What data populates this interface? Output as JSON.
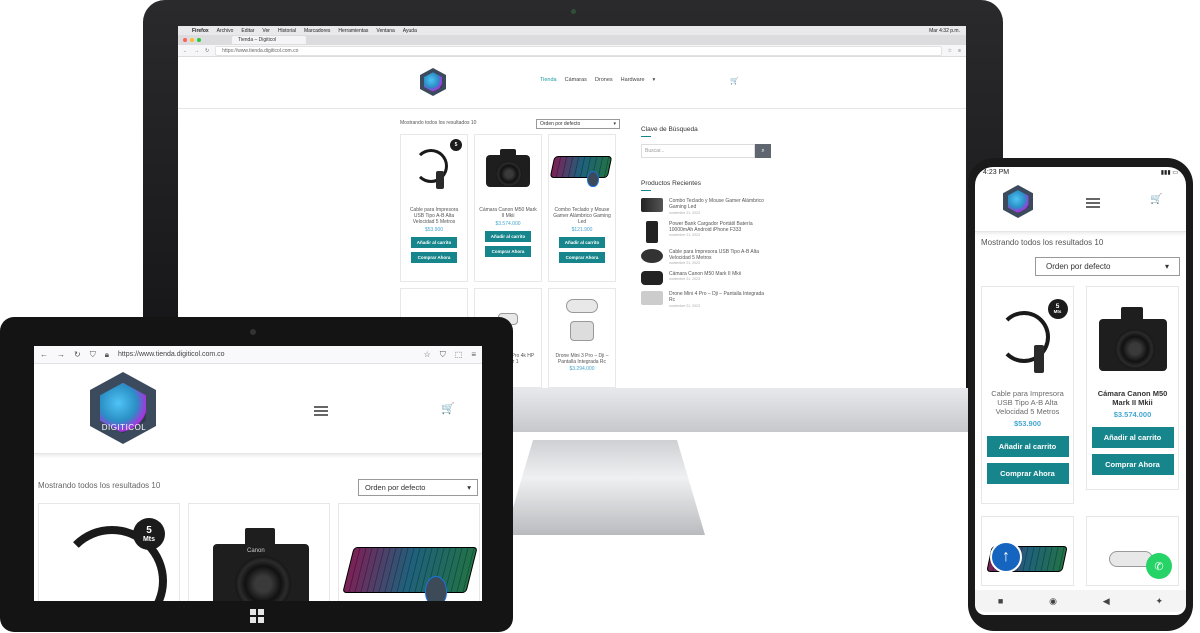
{
  "desktop": {
    "menubar": {
      "apple": "",
      "items": [
        "Firefox",
        "Archivo",
        "Editar",
        "Ver",
        "Historial",
        "Marcadores",
        "Herramientas",
        "Ventana",
        "Ayuda"
      ],
      "clock": "Mar 4:32 p.m."
    },
    "browser": {
      "tab_title": "Tienda – Digiticol",
      "url": "https://www.tienda.digiticol.com.co"
    },
    "nav": [
      "Tienda",
      "Cámaras",
      "Drones",
      "Hardware"
    ],
    "results_text": "Mostrando todos los resultados 10",
    "order_select": "Orden por defecto",
    "products": [
      {
        "title": "Cable para Impresora USB Tipo A-B Alta Velocidad 5 Metros",
        "price": "$53.900",
        "cart": "Añadir al carrito",
        "buy": "Comprar Ahora"
      },
      {
        "title": "Cámara Canon M50 Mark II Mkii",
        "price": "$3.574.000",
        "cart": "Añadir al carrito",
        "buy": "Comprar Ahora"
      },
      {
        "title": "Combo Teclado y Mouse Gamer Alámbrico Gaming Led",
        "price": "$121.900",
        "cart": "Añadir al carrito",
        "buy": "Comprar Ahora"
      }
    ],
    "row2_titles": [
      "",
      "Drone Mini 3 Pro 4k HP 5,8GHz 1",
      "Drone Mini 3 Pro – Dji – Pantalla Integrada Rc"
    ],
    "row2_prices": [
      "",
      "",
      "$3.294.000"
    ],
    "sidebar": {
      "search_title": "Clave de Búsqueda",
      "search_placeholder": "Buscar...",
      "recent_title": "Productos Recientes",
      "recent": [
        {
          "title": "Combo Teclado y Mouse Gamer Alámbrico Gaming Led",
          "date": "noviembre 21, 2023"
        },
        {
          "title": "Power Bank Cargador Portátil Batería 10000mAh Android iPhone F333",
          "date": "noviembre 21, 2023"
        },
        {
          "title": "Cable para Impresora USB Tipo A-B Alta Velocidad 5 Metros",
          "date": "noviembre 21, 2023"
        },
        {
          "title": "Cámara Canon M50 Mark II Mkii",
          "date": "noviembre 21, 2023"
        },
        {
          "title": "Drone Mini 4 Pro – Dji – Pantalla Integrada Rc",
          "date": "noviembre 21, 2023"
        }
      ]
    }
  },
  "tablet": {
    "url": "https://www.tienda.digiticol.com.co",
    "logo_text": "DIGITICOL",
    "results_text": "Mostrando todos los resultados 10",
    "order_select": "Orden por defecto",
    "badge_num": "5",
    "badge_unit": "Mts"
  },
  "phone": {
    "time": "4:23 PM",
    "results_text": "Mostrando todos los resultados 10",
    "order_select": "Orden por defecto",
    "badge_num": "5",
    "badge_unit": "Mts",
    "products": [
      {
        "title": "Cable para Impresora USB Tipo A-B Alta Velocidad 5 Metros",
        "price": "$53.900",
        "cart": "Añadir al carrito",
        "buy": "Comprar Ahora"
      },
      {
        "title": "Cámara Canon M50 Mark II Mkii",
        "price": "$3.574.000",
        "cart": "Añadir al carrito",
        "buy": "Comprar Ahora"
      }
    ]
  },
  "colors": {
    "accent": "#17868c",
    "price": "#45a6cf",
    "nav_active": "#1f9aa3"
  }
}
